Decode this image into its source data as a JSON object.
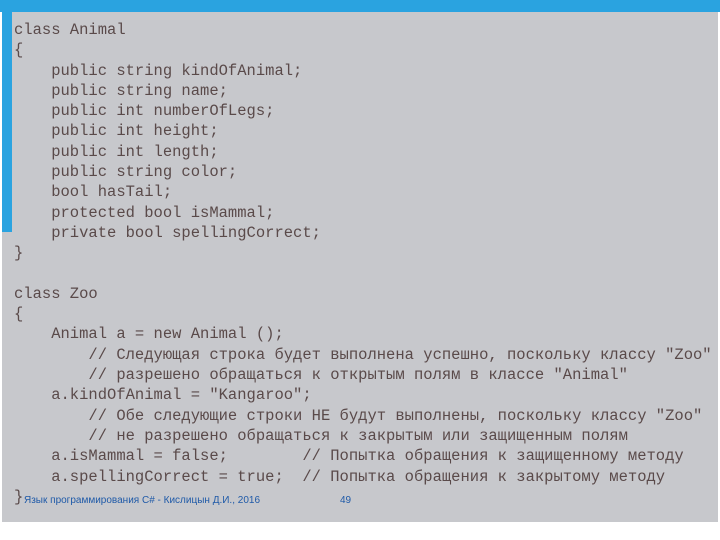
{
  "code": "class Animal\n{\n    public string kindOfAnimal;\n    public string name;\n    public int numberOfLegs;\n    public int height;\n    public int length;\n    public string color;\n    bool hasTail;\n    protected bool isMammal;\n    private bool spellingCorrect;\n}\n\nclass Zoo\n{\n    Animal a = new Animal ();\n        // Следующая строка будет выполнена успешно, поскольку классу \"Zoo\"\n        // разрешено обращаться к открытым полям в классе \"Animal\"\n    a.kindOfAnimal = \"Kangaroo\";\n        // Обе следующие строки НЕ будут выполнены, поскольку классу \"Zoo\"\n        // не разрешено обращаться к закрытым или защищенным полям\n    a.isMammal = false;        // Попытка обращения к защищенному методу\n    a.spellingCorrect = true;  // Попытка обращения к закрытому методу\n}",
  "footer": "Язык программирования C# - Кислицын Д.И., 2016",
  "page": "49"
}
